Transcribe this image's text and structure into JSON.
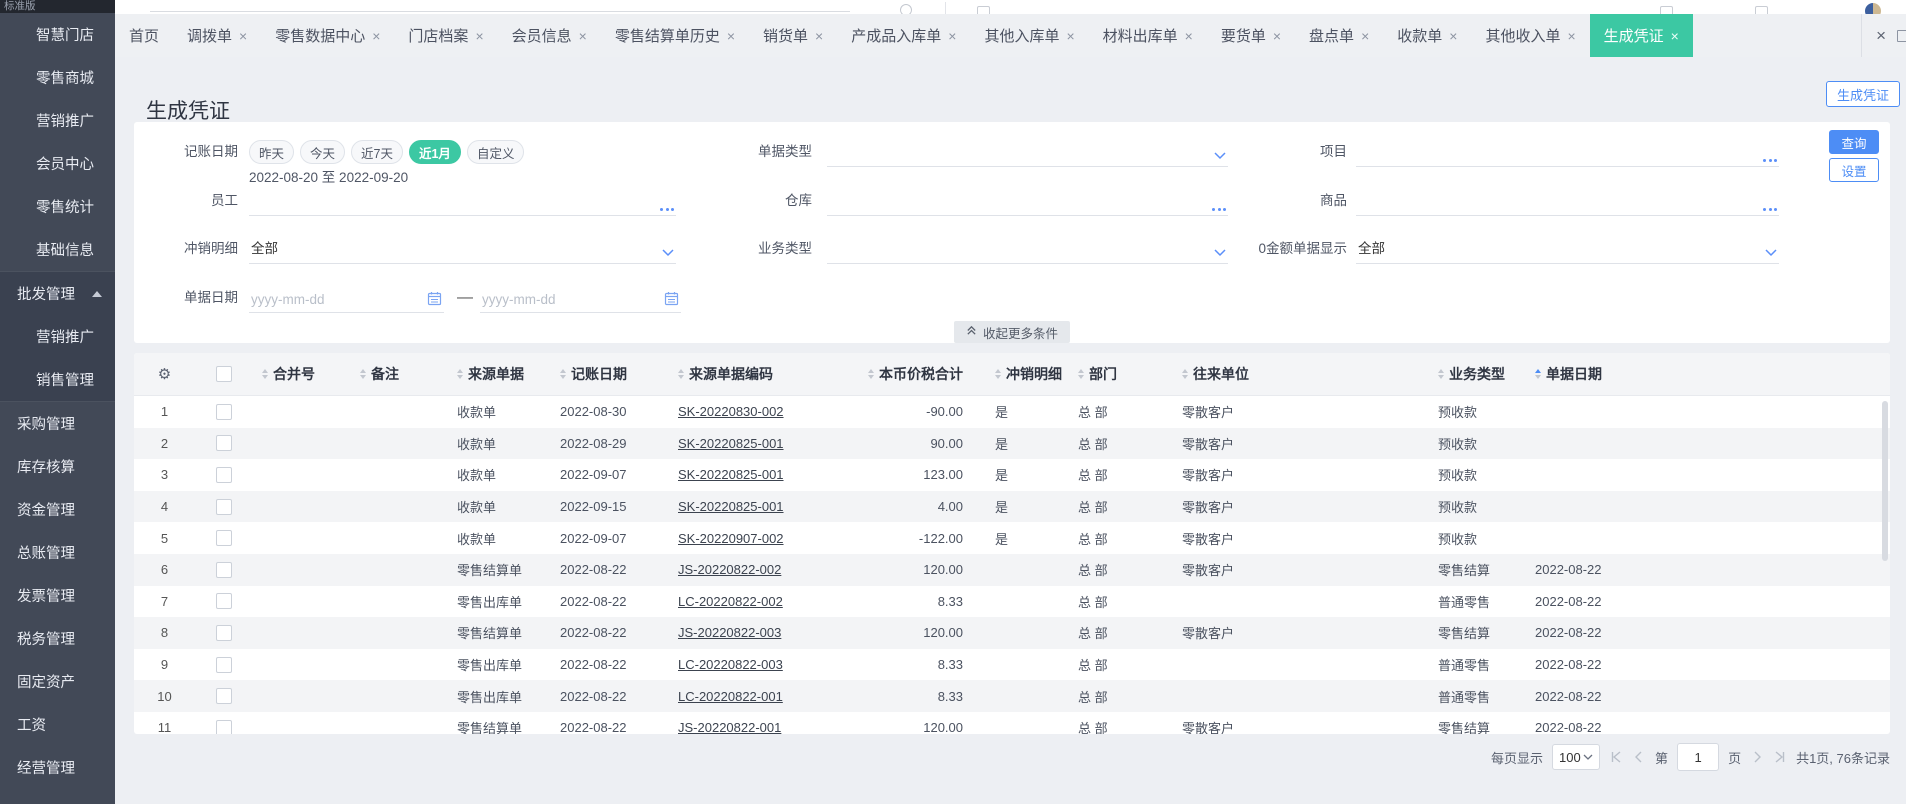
{
  "colors": {
    "accent_blue": "#4d8df5",
    "accent_green": "#3cc8a3"
  },
  "sidebar": {
    "edition": "标准版",
    "items": [
      {
        "name": "smart-store",
        "label": "智慧门店",
        "level": 2
      },
      {
        "name": "retail-mall",
        "label": "零售商城",
        "level": 2
      },
      {
        "name": "marketing-top",
        "label": "营销推广",
        "level": 2
      },
      {
        "name": "member-center",
        "label": "会员中心",
        "level": 2
      },
      {
        "name": "retail-stats",
        "label": "零售统计",
        "level": 2
      },
      {
        "name": "basic-info",
        "label": "基础信息",
        "level": 2
      },
      {
        "name": "wholesale-mgmt",
        "label": "批发管理",
        "level": 1,
        "expanded": true,
        "zone": "expanded",
        "zone_first": true
      },
      {
        "name": "marketing-promo",
        "label": "营销推广",
        "level": 2,
        "zone": "expanded"
      },
      {
        "name": "sales-mgmt",
        "label": "销售管理",
        "level": 2,
        "zone": "expanded",
        "zone_last": true
      },
      {
        "name": "purchase-mgmt",
        "label": "采购管理",
        "level": 1
      },
      {
        "name": "inventory-accounting",
        "label": "库存核算",
        "level": 1
      },
      {
        "name": "funds-mgmt",
        "label": "资金管理",
        "level": 1
      },
      {
        "name": "general-ledger",
        "label": "总账管理",
        "level": 1
      },
      {
        "name": "invoice-mgmt",
        "label": "发票管理",
        "level": 1
      },
      {
        "name": "tax-mgmt",
        "label": "税务管理",
        "level": 1
      },
      {
        "name": "fixed-assets",
        "label": "固定资产",
        "level": 1
      },
      {
        "name": "payroll",
        "label": "工资",
        "level": 1
      },
      {
        "name": "business-mgmt",
        "label": "经营管理",
        "level": 1
      }
    ]
  },
  "tabs": {
    "items": [
      {
        "name": "home",
        "label": "首页",
        "closable": false
      },
      {
        "name": "transfer-order",
        "label": "调拨单",
        "closable": true
      },
      {
        "name": "retail-data-center",
        "label": "零售数据中心",
        "closable": true
      },
      {
        "name": "store-archives",
        "label": "门店档案",
        "closable": true
      },
      {
        "name": "member-info",
        "label": "会员信息",
        "closable": true
      },
      {
        "name": "retail-settlement-history",
        "label": "零售结算单历史",
        "closable": true
      },
      {
        "name": "sales-order",
        "label": "销货单",
        "closable": true
      },
      {
        "name": "finished-goods-inbound",
        "label": "产成品入库单",
        "closable": true
      },
      {
        "name": "other-inbound",
        "label": "其他入库单",
        "closable": true
      },
      {
        "name": "material-outbound",
        "label": "材料出库单",
        "closable": true
      },
      {
        "name": "goods-request",
        "label": "要货单",
        "closable": true
      },
      {
        "name": "stocktake",
        "label": "盘点单",
        "closable": true
      },
      {
        "name": "receipt",
        "label": "收款单",
        "closable": true
      },
      {
        "name": "other-income",
        "label": "其他收入单",
        "closable": true
      },
      {
        "name": "generate-voucher",
        "label": "生成凭证",
        "closable": true,
        "active": true
      }
    ]
  },
  "page": {
    "title": "生成凭证",
    "generate_button_label": "生成凭证"
  },
  "filters": {
    "query_button": "查询",
    "settings_button": "设置",
    "collapse_label": "收起更多条件",
    "booking_date": {
      "label": "记账日期",
      "presets": [
        {
          "name": "yesterday",
          "label": "昨天"
        },
        {
          "name": "today",
          "label": "今天"
        },
        {
          "name": "last7days",
          "label": "近7天"
        },
        {
          "name": "last1month",
          "label": "近1月",
          "active": true
        },
        {
          "name": "custom",
          "label": "自定义"
        }
      ],
      "range_text": "2022-08-20 至 2022-09-20"
    },
    "doc_type": {
      "label": "单据类型",
      "value": ""
    },
    "project": {
      "label": "项目",
      "value": ""
    },
    "employee": {
      "label": "员工",
      "value": ""
    },
    "warehouse": {
      "label": "仓库",
      "value": ""
    },
    "goods": {
      "label": "商品",
      "value": ""
    },
    "writeoff_detail": {
      "label": "冲销明细",
      "value": "全部"
    },
    "biz_type": {
      "label": "业务类型",
      "value": ""
    },
    "zero_amount": {
      "label": "0金额单据显示",
      "value": "全部"
    },
    "doc_date": {
      "label": "单据日期",
      "from_placeholder": "yyyy-mm-dd",
      "to_placeholder": "yyyy-mm-dd",
      "separator": "—"
    }
  },
  "table": {
    "columns": [
      {
        "key": "merge",
        "label": "合并号"
      },
      {
        "key": "note",
        "label": "备注"
      },
      {
        "key": "source",
        "label": "来源单据"
      },
      {
        "key": "booking_date",
        "label": "记账日期"
      },
      {
        "key": "code",
        "label": "来源单据编码"
      },
      {
        "key": "amount",
        "label": "本币价税合计"
      },
      {
        "key": "writeoff",
        "label": "冲销明细"
      },
      {
        "key": "dept",
        "label": "部门"
      },
      {
        "key": "partner",
        "label": "往来单位"
      },
      {
        "key": "biz",
        "label": "业务类型"
      },
      {
        "key": "doc_date",
        "label": "单据日期",
        "sorted": "asc"
      }
    ],
    "rows": [
      {
        "no": "1",
        "merge": "",
        "note": "",
        "source": "收款单",
        "booking_date": "2022-08-30",
        "code": "SK-20220830-002",
        "amount": "-90.00",
        "writeoff": "是",
        "dept": "总 部",
        "partner": "零散客户",
        "biz": "预收款",
        "doc_date": ""
      },
      {
        "no": "2",
        "merge": "",
        "note": "",
        "source": "收款单",
        "booking_date": "2022-08-29",
        "code": "SK-20220825-001",
        "amount": "90.00",
        "writeoff": "是",
        "dept": "总 部",
        "partner": "零散客户",
        "biz": "预收款",
        "doc_date": ""
      },
      {
        "no": "3",
        "merge": "",
        "note": "",
        "source": "收款单",
        "booking_date": "2022-09-07",
        "code": "SK-20220825-001",
        "amount": "123.00",
        "writeoff": "是",
        "dept": "总 部",
        "partner": "零散客户",
        "biz": "预收款",
        "doc_date": ""
      },
      {
        "no": "4",
        "merge": "",
        "note": "",
        "source": "收款单",
        "booking_date": "2022-09-15",
        "code": "SK-20220825-001",
        "amount": "4.00",
        "writeoff": "是",
        "dept": "总 部",
        "partner": "零散客户",
        "biz": "预收款",
        "doc_date": ""
      },
      {
        "no": "5",
        "merge": "",
        "note": "",
        "source": "收款单",
        "booking_date": "2022-09-07",
        "code": "SK-20220907-002",
        "amount": "-122.00",
        "writeoff": "是",
        "dept": "总 部",
        "partner": "零散客户",
        "biz": "预收款",
        "doc_date": ""
      },
      {
        "no": "6",
        "merge": "",
        "note": "",
        "source": "零售结算单",
        "booking_date": "2022-08-22",
        "code": "JS-20220822-002",
        "amount": "120.00",
        "writeoff": "",
        "dept": "总 部",
        "partner": "零散客户",
        "biz": "零售结算",
        "doc_date": "2022-08-22"
      },
      {
        "no": "7",
        "merge": "",
        "note": "",
        "source": "零售出库单",
        "booking_date": "2022-08-22",
        "code": "LC-20220822-002",
        "amount": "8.33",
        "writeoff": "",
        "dept": "总 部",
        "partner": "",
        "biz": "普通零售",
        "doc_date": "2022-08-22"
      },
      {
        "no": "8",
        "merge": "",
        "note": "",
        "source": "零售结算单",
        "booking_date": "2022-08-22",
        "code": "JS-20220822-003",
        "amount": "120.00",
        "writeoff": "",
        "dept": "总 部",
        "partner": "零散客户",
        "biz": "零售结算",
        "doc_date": "2022-08-22"
      },
      {
        "no": "9",
        "merge": "",
        "note": "",
        "source": "零售出库单",
        "booking_date": "2022-08-22",
        "code": "LC-20220822-003",
        "amount": "8.33",
        "writeoff": "",
        "dept": "总 部",
        "partner": "",
        "biz": "普通零售",
        "doc_date": "2022-08-22"
      },
      {
        "no": "10",
        "merge": "",
        "note": "",
        "source": "零售出库单",
        "booking_date": "2022-08-22",
        "code": "LC-20220822-001",
        "amount": "8.33",
        "writeoff": "",
        "dept": "总 部",
        "partner": "",
        "biz": "普通零售",
        "doc_date": "2022-08-22"
      },
      {
        "no": "11",
        "merge": "",
        "note": "",
        "source": "零售结算单",
        "booking_date": "2022-08-22",
        "code": "JS-20220822-001",
        "amount": "120.00",
        "writeoff": "",
        "dept": "总 部",
        "partner": "零散客户",
        "biz": "零售结算",
        "doc_date": "2022-08-22"
      }
    ]
  },
  "pagination": {
    "per_page_label": "每页显示",
    "per_page_value": "100",
    "page_prefix": "第",
    "current_page": "1",
    "page_suffix": "页",
    "total_summary": "共1页, 76条记录"
  }
}
